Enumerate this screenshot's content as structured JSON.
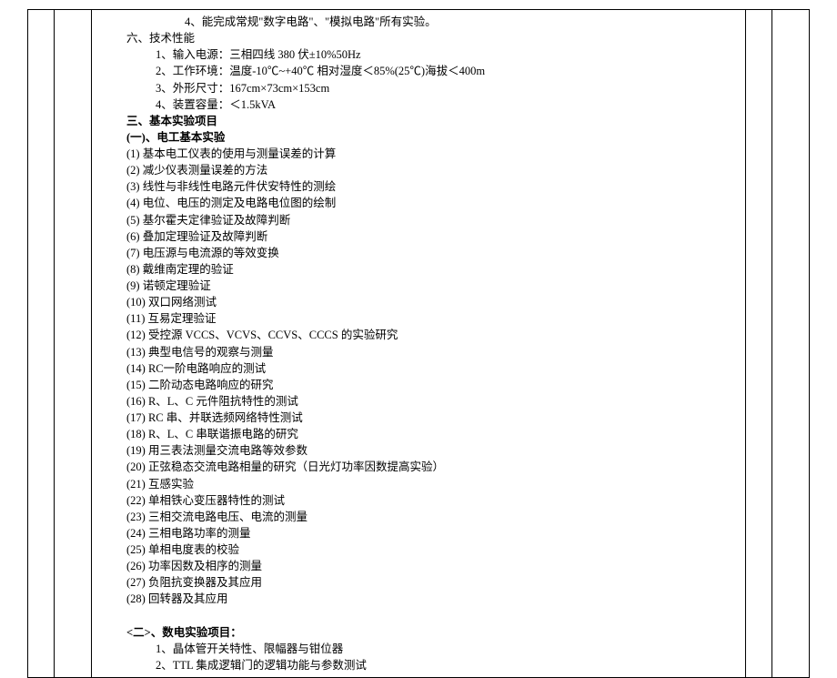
{
  "doc": {
    "l0": "4、能完成常规\"数字电路\"、\"模拟电路\"所有实验。",
    "section6_title": "六、技术性能",
    "spec1": "1、输入电源：三相四线 380 伏±10%50Hz",
    "spec2": "2、工作环境：温度-10℃~+40℃ 相对湿度＜85%(25℃)海拔＜400m",
    "spec3": "3、外形尺寸：167cm×73cm×153cm",
    "spec4": "4、装置容量：＜1.5kVA",
    "section3_title": "三、基本实验项目",
    "sub1_title": "(一)、电工基本实验",
    "e1": "(1) 基本电工仪表的使用与测量误差的计算",
    "e2": "(2) 减少仪表测量误差的方法",
    "e3": "(3) 线性与非线性电路元件伏安特性的测绘",
    "e4": "(4) 电位、电压的测定及电路电位图的绘制",
    "e5": "(5) 基尔霍夫定律验证及故障判断",
    "e6": "(6) 叠加定理验证及故障判断",
    "e7": "(7) 电压源与电流源的等效变换",
    "e8": "(8) 戴维南定理的验证",
    "e9": "(9) 诺顿定理验证",
    "e10": "(10) 双口网络测试",
    "e11": "(11) 互易定理验证",
    "e12": "(12) 受控源 VCCS、VCVS、CCVS、CCCS 的实验研究",
    "e13": "(13) 典型电信号的观察与测量",
    "e14": "(14) RC一阶电路响应的测试",
    "e15": "(15) 二阶动态电路响应的研究",
    "e16": "(16) R、L、C 元件阻抗特性的测试",
    "e17": "(17) RC 串、并联选频网络特性测试",
    "e18": "(18) R、L、C 串联谐振电路的研究",
    "e19": "(19) 用三表法测量交流电路等效参数",
    "e20": "(20) 正弦稳态交流电路相量的研究（日光灯功率因数提高实验）",
    "e21": "(21) 互感实验",
    "e22": "(22) 单相铁心变压器特性的测试",
    "e23": "(23) 三相交流电路电压、电流的测量",
    "e24": "(24) 三相电路功率的测量",
    "e25": "(25) 单相电度表的校验",
    "e26": "(26) 功率因数及相序的测量",
    "e27": "(27) 负阻抗变换器及其应用",
    "e28": "(28) 回转器及其应用",
    "sub2_title": "<二>、数电实验项目：",
    "d1": "1、晶体管开关特性、限幅器与钳位器",
    "d2": "2、TTL 集成逻辑门的逻辑功能与参数测试"
  }
}
